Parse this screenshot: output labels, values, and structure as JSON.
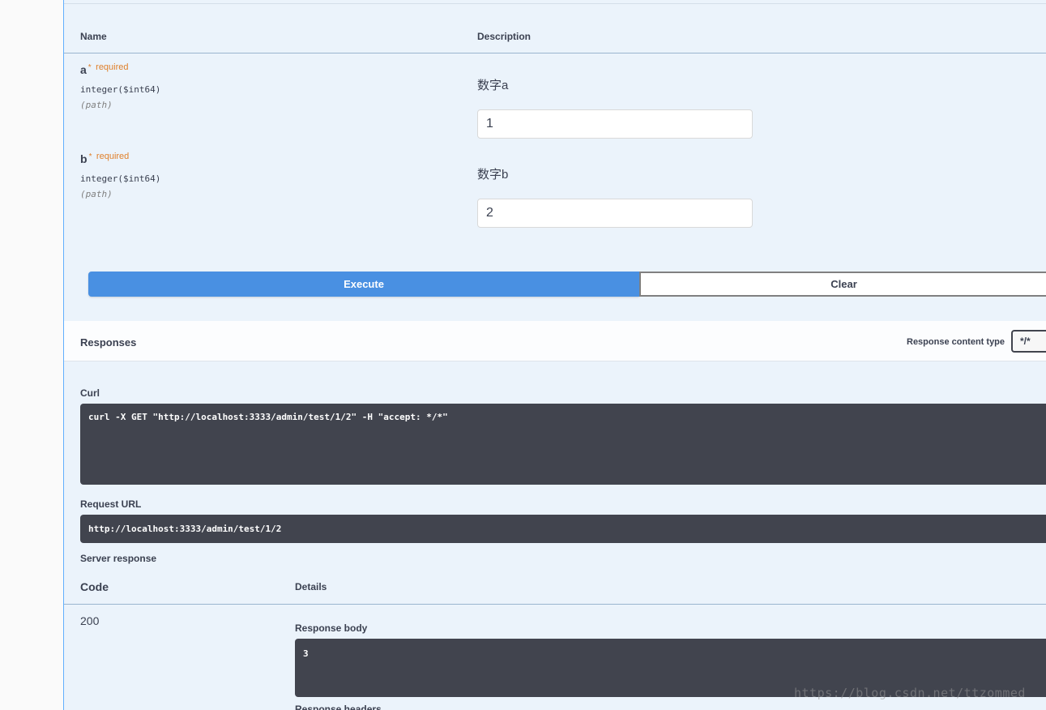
{
  "params": {
    "header_name": "Name",
    "header_description": "Description",
    "items": [
      {
        "name": "a",
        "star": "*",
        "required": "required",
        "type": "integer($int64)",
        "in": "(path)",
        "description": "数字a",
        "value": "1"
      },
      {
        "name": "b",
        "star": "*",
        "required": "required",
        "type": "integer($int64)",
        "in": "(path)",
        "description": "数字b",
        "value": "2"
      }
    ]
  },
  "buttons": {
    "execute": "Execute",
    "clear": "Clear"
  },
  "responses": {
    "title": "Responses",
    "content_type_label": "Response content type",
    "content_type_value": "*/*"
  },
  "curl": {
    "label": "Curl",
    "command": "curl -X GET \"http://localhost:3333/admin/test/1/2\" -H \"accept: */*\""
  },
  "request_url": {
    "label": "Request URL",
    "value": "http://localhost:3333/admin/test/1/2"
  },
  "server_response": {
    "label": "Server response",
    "code_header": "Code",
    "details_header": "Details",
    "code": "200",
    "body_label": "Response body",
    "body": "3",
    "headers_label": "Response headers"
  },
  "watermark": "https://blog.csdn.net/ttzommed"
}
